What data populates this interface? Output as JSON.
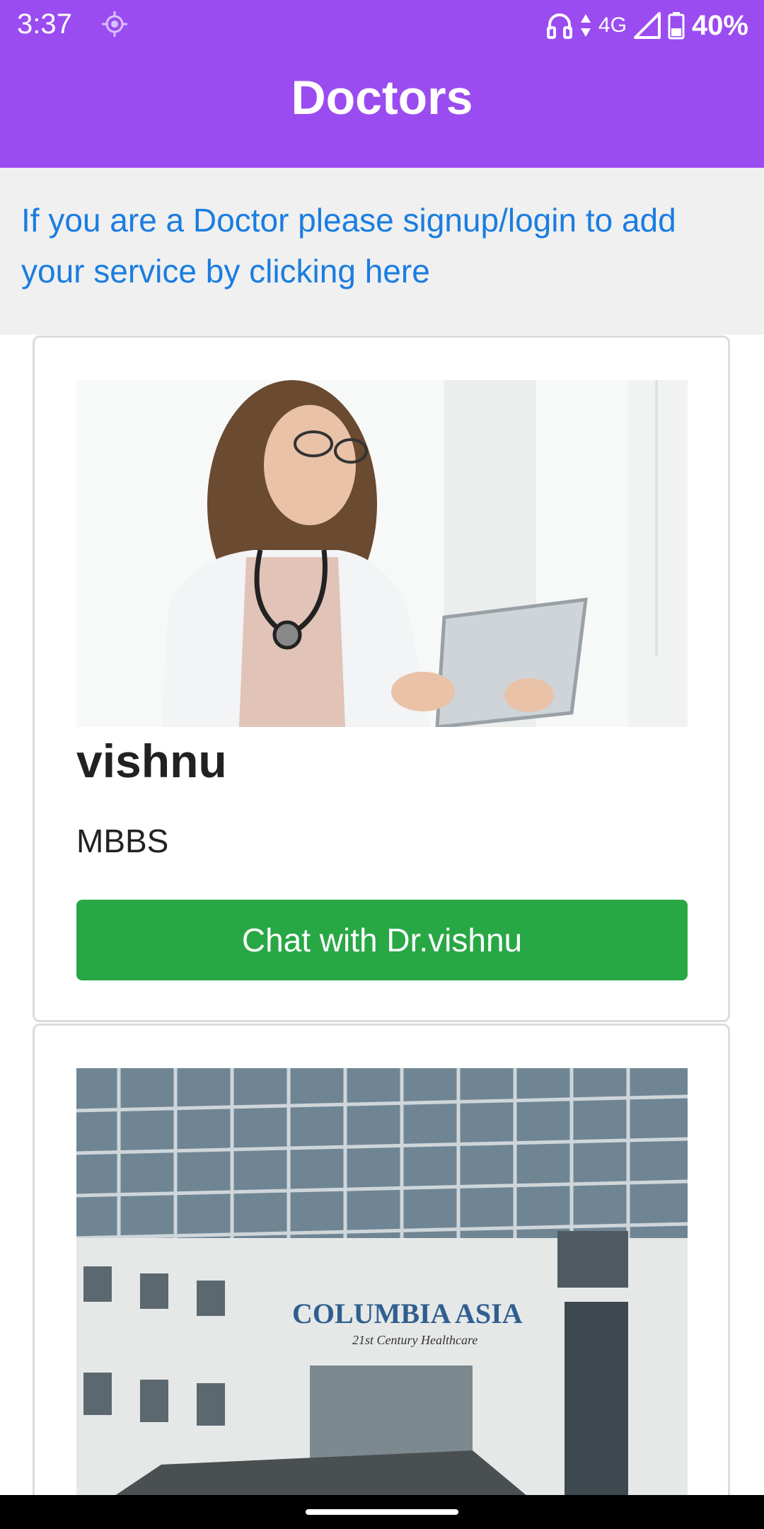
{
  "status_bar": {
    "time": "3:37",
    "network": "4G",
    "battery": "40%",
    "icons": [
      "location-icon",
      "headset-icon",
      "data-arrows-icon",
      "signal-icon",
      "battery-icon"
    ]
  },
  "app_bar": {
    "title": "Doctors"
  },
  "notice": {
    "text": "If you are a Doctor please signup/login to add your service by clicking here"
  },
  "doctors": [
    {
      "name": "vishnu",
      "qualification": "MBBS",
      "chat_label": "Chat with Dr.vishnu",
      "photo": "doctor-photo"
    },
    {
      "photo": "hospital-building-photo",
      "sign_text": "COLUMBIA ASIA",
      "sign_tagline": "21st Century Healthcare"
    }
  ],
  "colors": {
    "primary": "#9b4cf0",
    "link": "#1a7de0",
    "button": "#28a745",
    "notice_bg": "#f0f0f0"
  }
}
